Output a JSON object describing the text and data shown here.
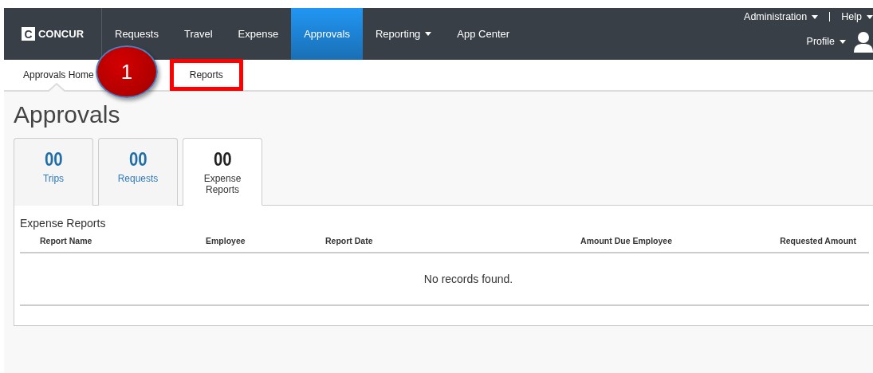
{
  "logo": {
    "mark": "C",
    "name": "CONCUR"
  },
  "nav": [
    {
      "label": "Requests",
      "selected": false,
      "dropdown": false
    },
    {
      "label": "Travel",
      "selected": false,
      "dropdown": false
    },
    {
      "label": "Expense",
      "selected": false,
      "dropdown": false
    },
    {
      "label": "Approvals",
      "selected": true,
      "dropdown": false
    },
    {
      "label": "Reporting",
      "selected": false,
      "dropdown": true
    },
    {
      "label": "App Center",
      "selected": false,
      "dropdown": false
    }
  ],
  "top_links": [
    {
      "label": "Administration",
      "dropdown": true
    },
    {
      "label": "Help",
      "dropdown": true
    }
  ],
  "profile": {
    "label": "Profile"
  },
  "subnav": [
    {
      "label": "Approvals Home",
      "selected": true,
      "highlighted": false
    },
    {
      "label": "Reports",
      "selected": false,
      "highlighted": true
    }
  ],
  "callout": {
    "label": "1"
  },
  "title": "Approvals",
  "tabs": [
    {
      "count": "00",
      "label": "Trips",
      "selected": false
    },
    {
      "count": "00",
      "label": "Requests",
      "selected": false
    },
    {
      "count": "00",
      "label": "Expense Reports",
      "selected": true
    }
  ],
  "panel": {
    "title": "Expense Reports",
    "columns": [
      "Report Name",
      "Employee",
      "Report Date",
      "Amount Due Employee",
      "Requested Amount"
    ],
    "empty_message": "No records found."
  }
}
